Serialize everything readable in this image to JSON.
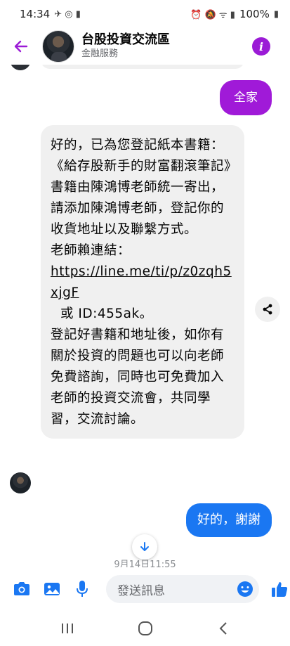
{
  "status_bar": {
    "time": "14:34",
    "battery": "100%"
  },
  "header": {
    "title": "台股投資交流區",
    "subtitle": "金融服務"
  },
  "messages": {
    "outgoing_1": "全家",
    "incoming": {
      "p1": "好的，已為您登記紙本書籍：《給存股新手的財富翻滾筆記》",
      "p2": "書籍由陳鴻博老師統一寄出，請添加陳鴻博老師，登記你的收貨地址以及聯繫方式。",
      "p3_label": "老師賴連結：",
      "p3_link": "https://line.me/ti/p/z0zqh5xjgF",
      "p3_id": "或 ID:455ak。",
      "p4": "登記好書籍和地址後，如你有關於投資的問題也可以向老師免費諮詢，同時也可免費加入老師的投資交流會，共同學習，交流討論。"
    },
    "outgoing_2": "好的，謝謝",
    "timestamp": "9月14日11:55"
  },
  "composer": {
    "placeholder": "發送訊息"
  },
  "colors": {
    "purple": "#a01ad8",
    "blue": "#1a77f2",
    "incoming_bg": "#f0f0f0"
  },
  "icons": {
    "back": "back-arrow-icon",
    "info": "info-icon",
    "share": "share-icon",
    "camera": "camera-icon",
    "gallery": "image-icon",
    "mic": "microphone-icon",
    "emoji": "emoji-icon",
    "like": "thumbs-up-icon"
  }
}
